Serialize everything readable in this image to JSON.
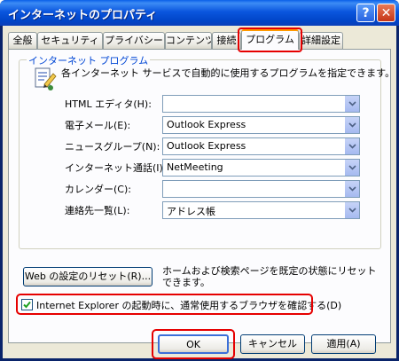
{
  "window": {
    "title": "インターネットのプロパティ"
  },
  "title_buttons": {
    "help": "?",
    "close": "✕"
  },
  "tabs": [
    {
      "label": "全般"
    },
    {
      "label": "セキュリティ"
    },
    {
      "label": "プライバシー"
    },
    {
      "label": "コンテンツ"
    },
    {
      "label": "接続"
    },
    {
      "label": "プログラム",
      "active": true
    },
    {
      "label": "詳細設定"
    }
  ],
  "group": {
    "title": "インターネット プログラム",
    "description": "各インターネット サービスで自動的に使用するプログラムを指定できます。",
    "icon": "program-settings-icon",
    "rows": [
      {
        "label": "HTML エディタ(H):",
        "value": ""
      },
      {
        "label": "電子メール(E):",
        "value": "Outlook Express"
      },
      {
        "label": "ニュースグループ(N):",
        "value": "Outlook Express"
      },
      {
        "label": "インターネット通話(I):",
        "value": "NetMeeting"
      },
      {
        "label": "カレンダー(C):",
        "value": ""
      },
      {
        "label": "連絡先一覧(L):",
        "value": "アドレス帳"
      }
    ]
  },
  "reset": {
    "button_label": "Web の設定のリセット(R)...",
    "description": "ホームおよび検索ページを既定の状態にリセットできます。"
  },
  "default_browser": {
    "label": "Internet Explorer の起動時に、通常使用するブラウザを確認する(D)",
    "checked": true
  },
  "footer": {
    "ok": "OK",
    "cancel": "キャンセル",
    "apply": "適用(A)"
  },
  "colors": {
    "highlight": "#e60000",
    "titlebar": "#0054e3",
    "dialog_bg": "#ece9d8"
  }
}
